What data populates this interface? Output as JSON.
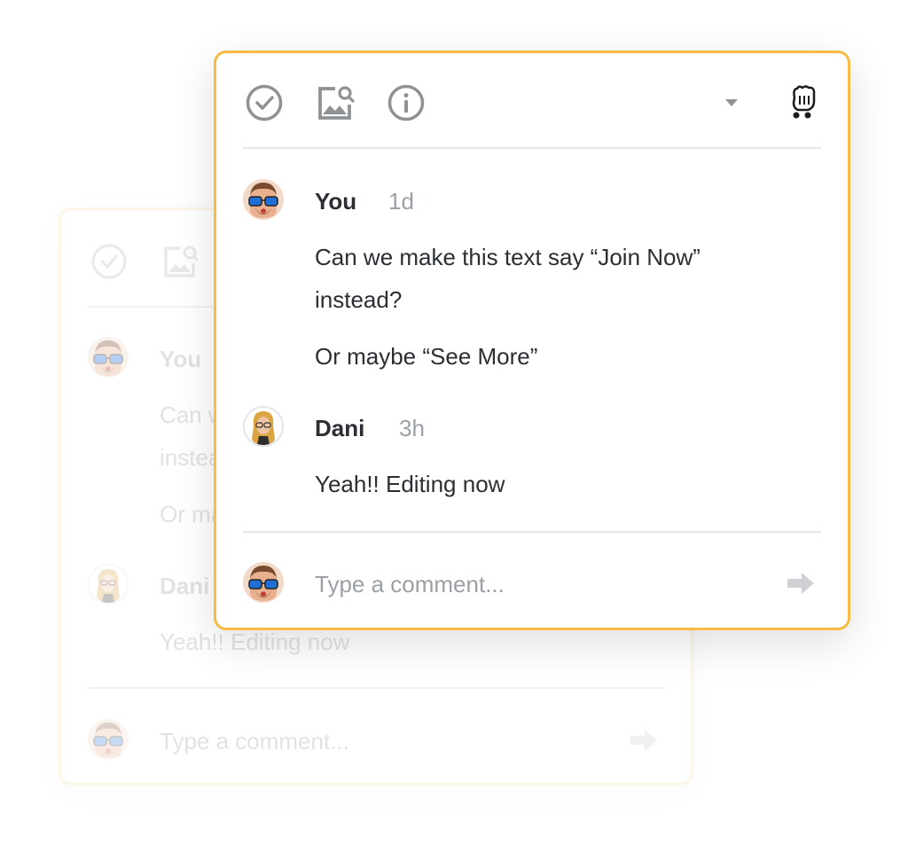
{
  "toolbar": {
    "icons": [
      "check-circle-icon",
      "image-search-icon",
      "info-icon",
      "caret-down-icon",
      "hand-cursor-icon"
    ]
  },
  "comments": [
    {
      "author": "You",
      "time": "1d",
      "avatar": "bitmoji-man-glasses",
      "lines": [
        "Can we make this text say “Join Now”",
        "instead?"
      ],
      "extra": "Or maybe “See More”"
    },
    {
      "author": "Dani",
      "time": "3h",
      "avatar": "bitmoji-woman-blonde",
      "lines": [
        "Yeah!! Editing now"
      ]
    }
  ],
  "composer": {
    "placeholder": "Type a comment..."
  },
  "colors": {
    "accent": "#f7bb46",
    "accent_faded": "#fdefd2",
    "text": "#2b2f33",
    "muted": "#9aa0a6",
    "icon": "#8f9295"
  }
}
